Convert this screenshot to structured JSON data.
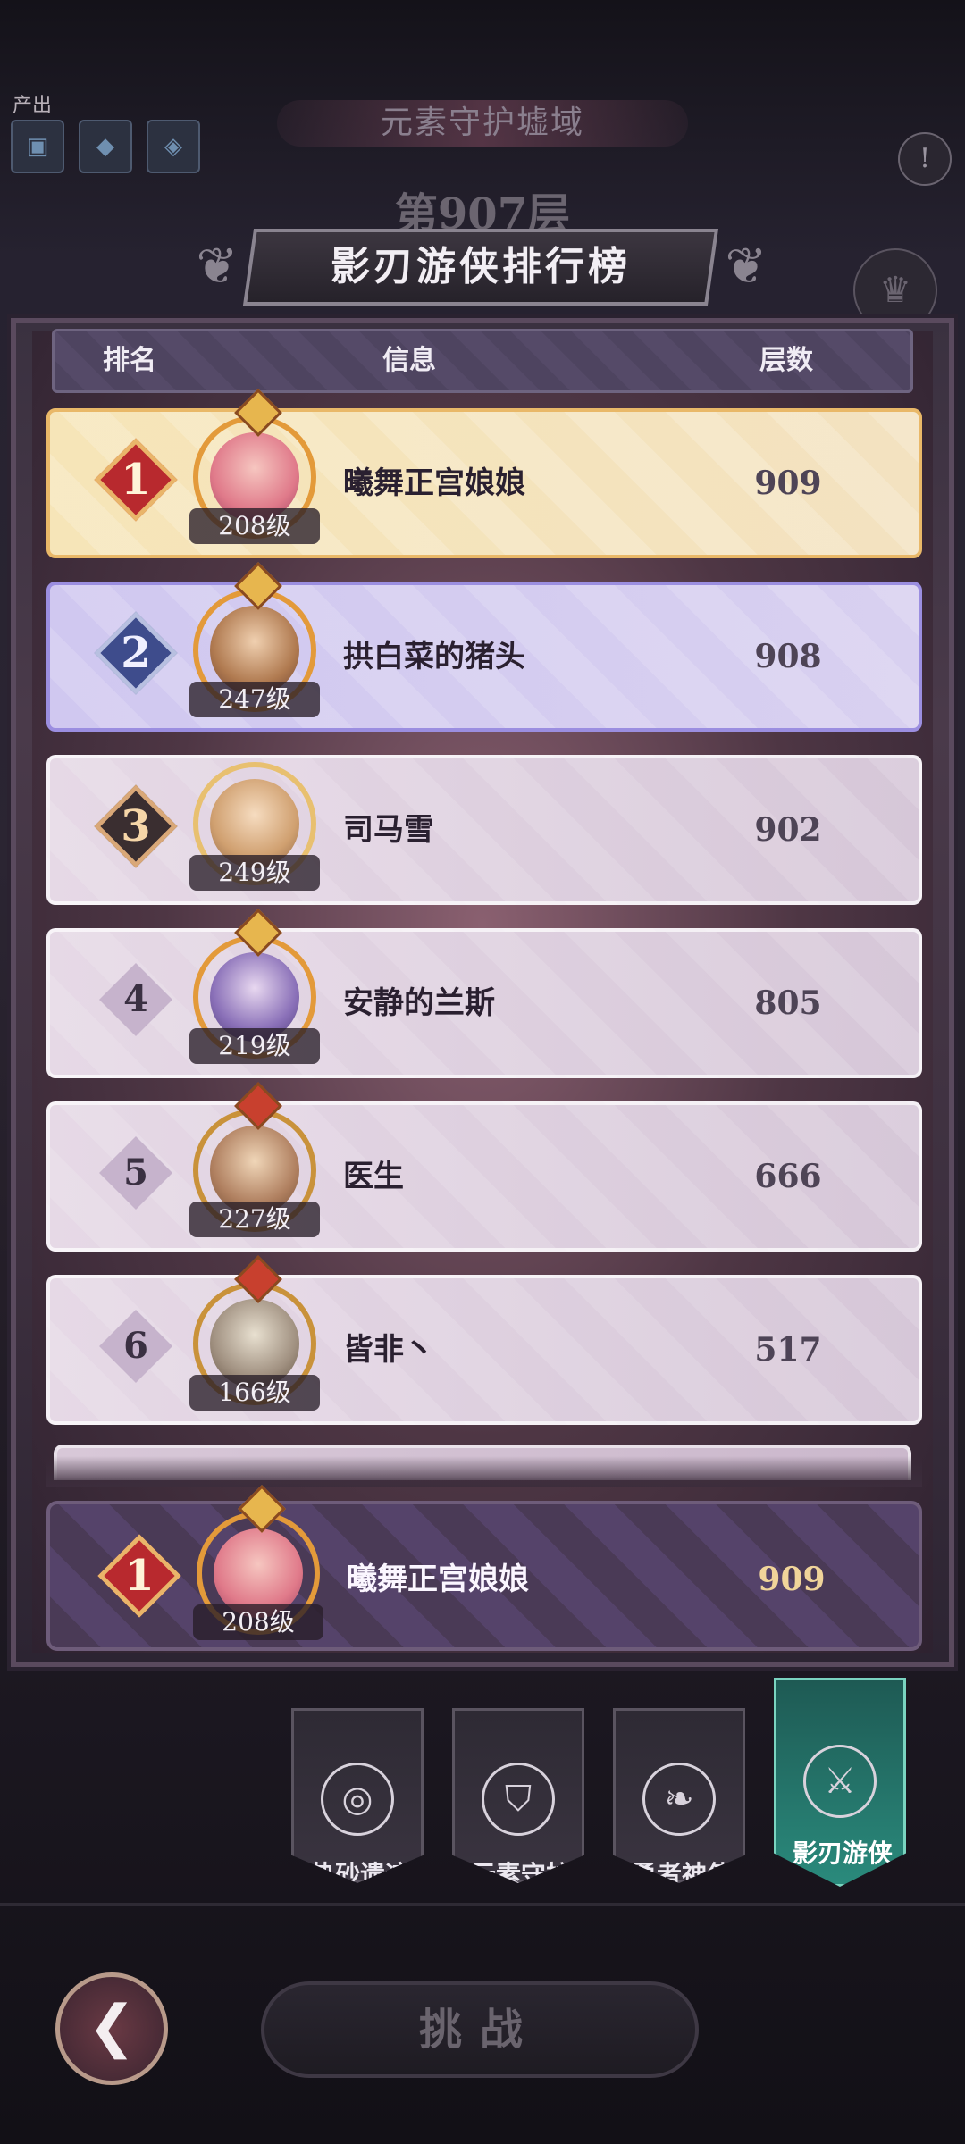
{
  "background": {
    "output_label": "产出",
    "output_icons": [
      "chest-icon",
      "crystal-icon",
      "gem-icon"
    ],
    "region_title": "元素守护墟域",
    "floor_title": "第907层"
  },
  "leaderboard": {
    "title": "影刃游侠排行榜",
    "headers": {
      "rank": "排名",
      "info": "信息",
      "floor": "层数"
    },
    "rows": [
      {
        "rank": "1",
        "name": "曦舞正宫娘娘",
        "level": "208级",
        "floor": "909",
        "badge": "gold",
        "row_style": "gold"
      },
      {
        "rank": "2",
        "name": "拱白菜的猪头",
        "level": "247级",
        "floor": "908",
        "badge": "blue",
        "row_style": "violet"
      },
      {
        "rank": "3",
        "name": "司马雪",
        "level": "249级",
        "floor": "902",
        "badge": "bronze",
        "row_style": "plain"
      },
      {
        "rank": "4",
        "name": "安静的兰斯",
        "level": "219级",
        "floor": "805",
        "badge": "plain",
        "row_style": "plain"
      },
      {
        "rank": "5",
        "name": "医生",
        "level": "227级",
        "floor": "666",
        "badge": "plain",
        "row_style": "plain"
      },
      {
        "rank": "6",
        "name": "皆非丶",
        "level": "166级",
        "floor": "517",
        "badge": "plain",
        "row_style": "plain"
      }
    ],
    "self": {
      "rank": "1",
      "name": "曦舞正宫娘娘",
      "level": "208级",
      "floor": "909"
    }
  },
  "tabs": [
    {
      "label": "热砂遗迹",
      "icon": "swirl-icon",
      "active": false
    },
    {
      "label": "元素守护",
      "icon": "shield-icon",
      "active": false
    },
    {
      "label": "勇者神使",
      "icon": "leaf-icon",
      "active": false
    },
    {
      "label": "影刃游侠",
      "icon": "crossed-blades-icon",
      "active": true
    }
  ],
  "actions": {
    "back_icon": "back-arrow-icon",
    "challenge": "挑战"
  },
  "colors": {
    "gold": "#e9b868",
    "violet": "#9b8ee0",
    "active_tab": "#2a8a7c"
  }
}
